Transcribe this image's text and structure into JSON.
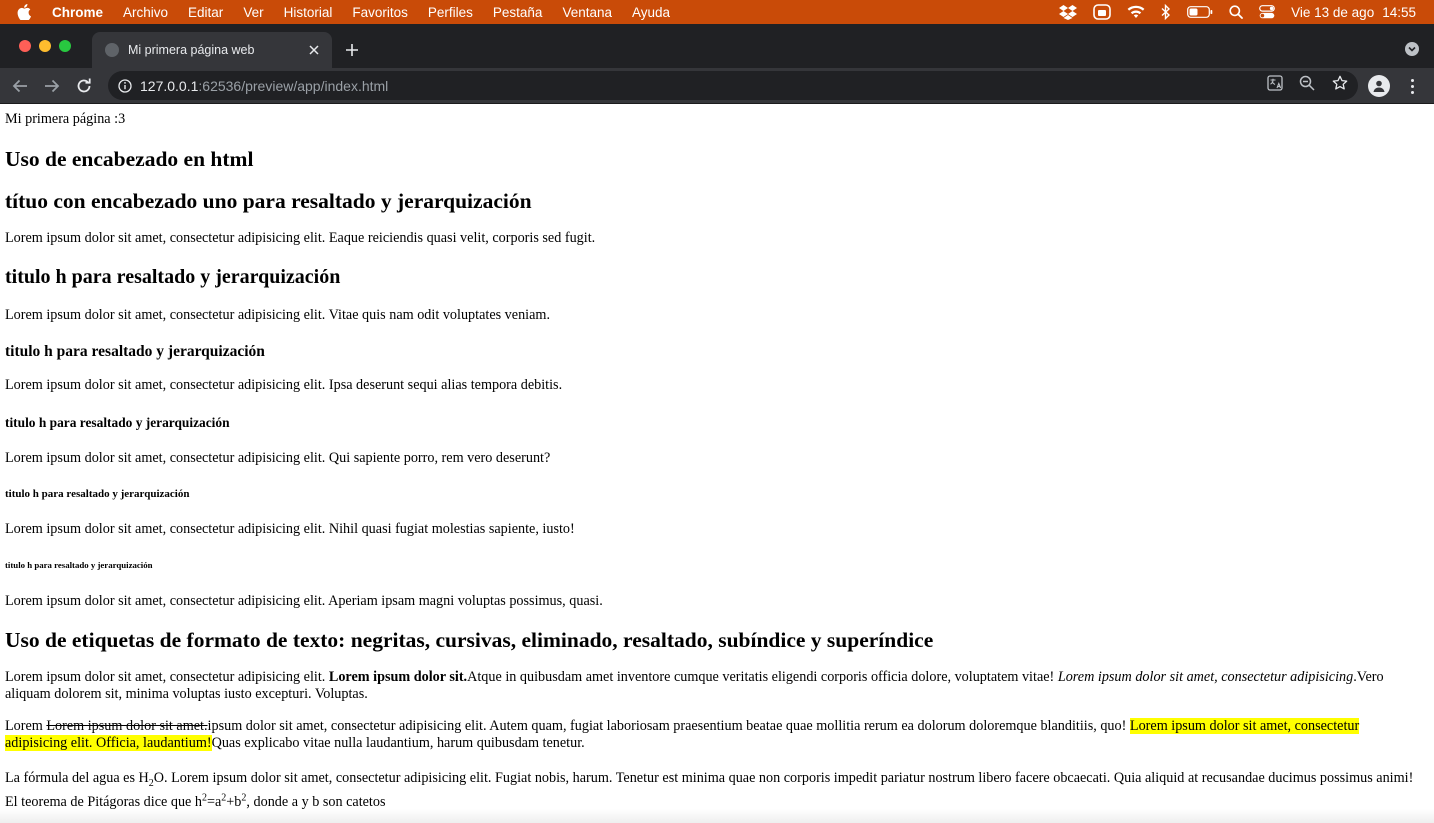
{
  "menubar": {
    "app": "Chrome",
    "items": [
      "Archivo",
      "Editar",
      "Ver",
      "Historial",
      "Favoritos",
      "Perfiles",
      "Pestaña",
      "Ventana",
      "Ayuda"
    ],
    "date": "Vie 13 de ago",
    "time": "14:55",
    "status_icons": [
      "dropbox-icon",
      "cloud-sync-icon",
      "wifi-icon",
      "bluetooth-icon",
      "battery-icon",
      "spotlight-search-icon",
      "control-center-icon"
    ]
  },
  "browser": {
    "tab_title": "Mi primera página web",
    "url_host": "127.0.0.1",
    "url_rest": ":62536/preview/app/index.html",
    "colors": {
      "menubar": "#c94b08",
      "tabstrip": "#202124",
      "toolbar": "#35363a"
    }
  },
  "page": {
    "intro": "Mi primera página :3",
    "h1_headers": "Uso de encabezado en html",
    "h2_title": "títuo con encabezado uno para resaltado y jerarquización",
    "p1": "Lorem ipsum dolor sit amet, consectetur adipisicing elit. Eaque reiciendis quasi velit, corporis sed fugit.",
    "h2_b": "titulo h para resaltado y jerarquización",
    "p2": "Lorem ipsum dolor sit amet, consectetur adipisicing elit. Vitae quis nam odit voluptates veniam.",
    "h3": "titulo h para resaltado y jerarquización",
    "p3": "Lorem ipsum dolor sit amet, consectetur adipisicing elit. Ipsa deserunt sequi alias tempora debitis.",
    "h4": "titulo h para resaltado y jerarquización",
    "p4": "Lorem ipsum dolor sit amet, consectetur adipisicing elit. Qui sapiente porro, rem vero deserunt?",
    "h5": "titulo h para resaltado y jerarquización",
    "p5": "Lorem ipsum dolor sit amet, consectetur adipisicing elit. Nihil quasi fugiat molestias sapiente, iusto!",
    "h6": "titulo h para resaltado y jerarquización",
    "p6": "Lorem ipsum dolor sit amet, consectetur adipisicing elit. Aperiam ipsam magni voluptas possimus, quasi.",
    "h1_format": "Uso de etiquetas de formato de texto: negritas, cursivas, eliminado, resaltado, subíndice y superíndice",
    "fmt1": {
      "a": "Lorem ipsum dolor sit amet, consectetur adipisicing elit. ",
      "bold": "Lorem ipsum dolor sit.",
      "b": "Atque in quibusdam amet inventore cumque veritatis eligendi corporis officia dolore, voluptatem vitae! ",
      "italic": "Lorem ipsum dolor sit amet, consectetur adipisicing",
      "c": ".Vero aliquam dolorem sit, minima voluptas iusto excepturi. Voluptas."
    },
    "fmt2": {
      "a": "Lorem ",
      "deleted": "Lorem ipsum dolor sit amet.",
      "b": "ipsum dolor sit amet, consectetur adipisicing elit. Autem quam, fugiat laboriosam praesentium beatae quae mollitia rerum ea dolorum doloremque blanditiis, quo! ",
      "marked": "Lorem ipsum dolor sit amet, consectetur adipisicing elit. Officia, laudantium!",
      "c": "Quas explicabo vitae nulla laudantium, harum quibusdam tenetur."
    },
    "fmt3": {
      "a": "La fórmula del agua es H",
      "sub": "2",
      "b": "O. Lorem ipsum dolor sit amet, consectetur adipisicing elit. Fugiat nobis, harum. Tenetur est minima quae non corporis impedit pariatur nostrum libero facere obcaecati. Quia aliquid at recusandae ducimus possimus animi! El teorema de Pitágoras dice que h",
      "sup1": "2",
      "c": "=a",
      "sup2": "2",
      "d": "+b",
      "sup3": "2",
      "e": ", donde a y b son catetos"
    }
  }
}
